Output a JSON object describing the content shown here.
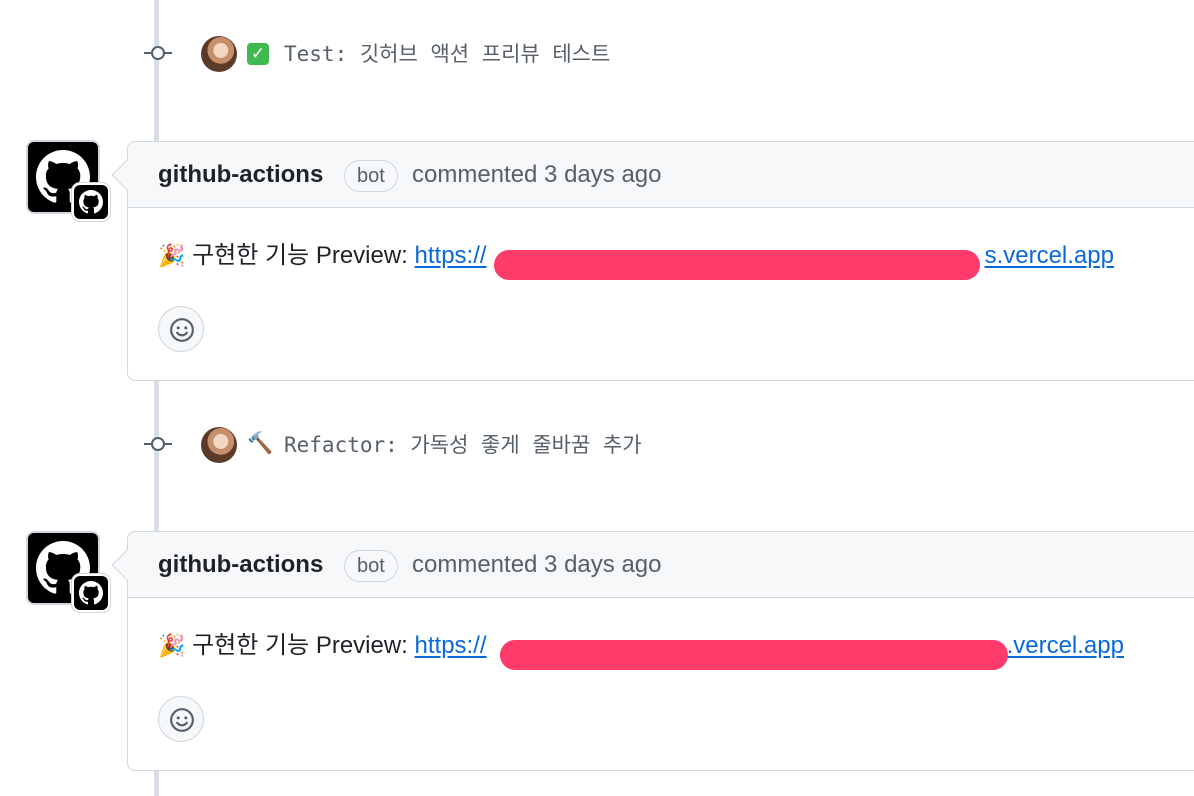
{
  "commits": [
    {
      "icon": "check-box-emoji",
      "emoji": "✓",
      "message": "Test: 깃허브 액션 프리뷰 테스트"
    },
    {
      "icon": "hammer-emoji",
      "emoji": "🔨",
      "message": "Refactor: 가독성 좋게 줄바꿈 추가"
    }
  ],
  "comments": [
    {
      "author": "github-actions",
      "badge": "bot",
      "meta": "commented 3 days ago",
      "emoji": "🎉",
      "prefix": "구현한 기능 Preview:",
      "link_start": "https://",
      "link_end": "s.vercel.app"
    },
    {
      "author": "github-actions",
      "badge": "bot",
      "meta": "commented 3 days ago",
      "emoji": "🎉",
      "prefix": "구현한 기능 Preview:",
      "link_start": "https://",
      "link_end": ".vercel.app"
    }
  ],
  "colors": {
    "link": "#0969da",
    "redaction": "#ff3b6b",
    "timeline": "#d8dee4"
  }
}
